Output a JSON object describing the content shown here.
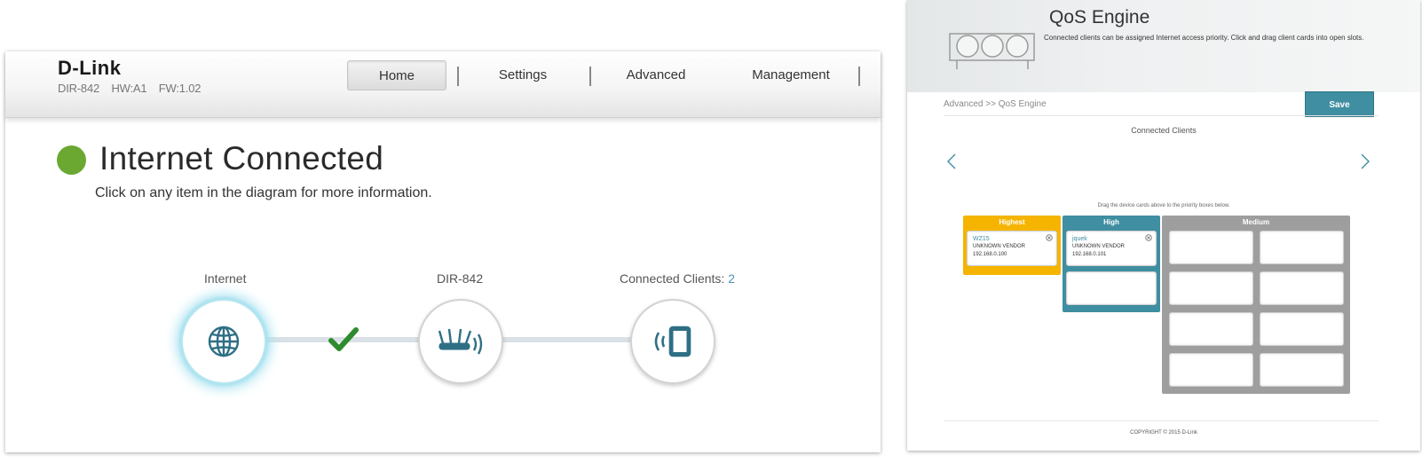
{
  "router": {
    "brand": "D-Link",
    "model": "DIR-842",
    "hw": "HW:A1",
    "fw": "FW:1.02"
  },
  "nav": {
    "items": [
      {
        "label": "Home"
      },
      {
        "label": "Settings"
      },
      {
        "label": "Advanced"
      },
      {
        "label": "Management"
      }
    ],
    "active": "Home"
  },
  "status": {
    "title": "Internet Connected",
    "subtitle": "Click on any item in the diagram for more information.",
    "color": "#6aa832"
  },
  "diagram": {
    "internet_label": "Internet",
    "router_label": "DIR-842",
    "clients_label": "Connected Clients:",
    "clients_count": "2",
    "internet_icon": "globe-icon",
    "router_icon": "router-icon",
    "clients_icon": "tablet-wireless-icon",
    "link_status_icon": "checkmark-icon"
  },
  "qos": {
    "title": "QoS Engine",
    "description": "Connected clients can be assigned Internet access priority. Click and drag client cards into open slots.",
    "breadcrumb": "Advanced >> QoS Engine",
    "save_label": "Save",
    "connected_clients_title": "Connected Clients",
    "drag_hint": "Drag the device cards above to the priority boxes below.",
    "priorities": {
      "highest": {
        "label": "Highest",
        "color": "#f5b400",
        "clients": [
          {
            "name": "WZ15",
            "vendor": "UNKNOWN VENDOR",
            "ip": "192.168.0.100"
          }
        ]
      },
      "high": {
        "label": "High",
        "color": "#3f8ea1",
        "clients": [
          {
            "name": "jquek",
            "vendor": "UNKNOWN VENDOR",
            "ip": "192.168.0.101"
          }
        ]
      },
      "medium": {
        "label": "Medium",
        "color": "#9e9e9e",
        "clients": []
      }
    },
    "copyright": "COPYRIGHT © 2015 D-Link",
    "accent": "#3f8ea1"
  }
}
